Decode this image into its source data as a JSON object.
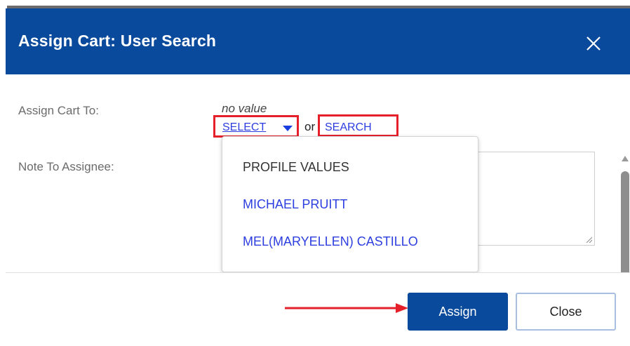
{
  "dialog": {
    "title": "Assign Cart: User Search",
    "close_icon": "close-icon"
  },
  "form": {
    "assign_cart_to_label": "Assign Cart To:",
    "assign_cart_to_value": "no value",
    "select_label": "SELECT",
    "or_text": "or",
    "search_label": "SEARCH",
    "note_label": "Note To Assignee:",
    "note_value": ""
  },
  "dropdown": {
    "header": "PROFILE VALUES",
    "options": [
      "MICHAEL PRUITT",
      "MEL(MARYELLEN) CASTILLO"
    ]
  },
  "footer": {
    "assign_label": "Assign",
    "close_label": "Close"
  },
  "colors": {
    "header_bg": "#0a4a9c",
    "link": "#2d3ee0",
    "highlight": "#e5202a"
  }
}
